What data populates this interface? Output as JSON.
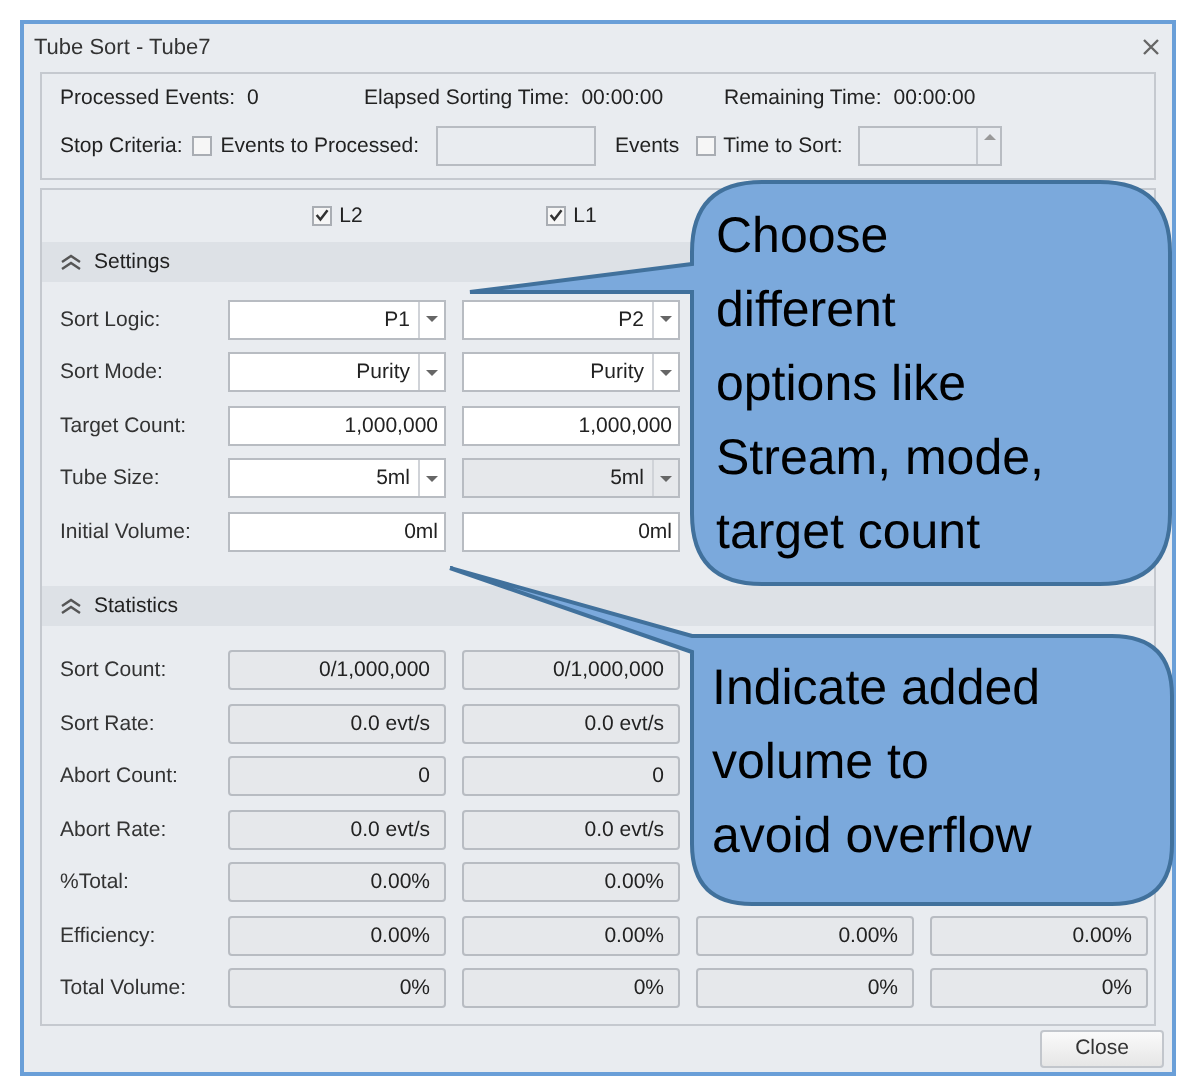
{
  "window": {
    "title": "Tube Sort - Tube7"
  },
  "summary": [
    {
      "label": "Processed Events:",
      "value": "0"
    },
    {
      "label": "Elapsed Sorting Time:",
      "value": "00:00:00"
    },
    {
      "label": "Remaining Time:",
      "value": "00:00:00"
    }
  ],
  "stop_criteria": {
    "label": "Stop Criteria:",
    "events_option": {
      "label": "Events to Processed:",
      "checked": false
    },
    "events_unit": "Events",
    "time_option": {
      "label": "Time to Sort:",
      "checked": false
    }
  },
  "streams": [
    {
      "label": "L2",
      "checked": true
    },
    {
      "label": "L1",
      "checked": true
    }
  ],
  "settings": {
    "title": "Settings",
    "rows": [
      {
        "label": "Sort Logic:",
        "kind": "dropdown",
        "cells": [
          {
            "value": "P1",
            "disabled": false
          },
          {
            "value": "P2",
            "disabled": false
          }
        ]
      },
      {
        "label": "Sort Mode:",
        "kind": "dropdown",
        "cells": [
          {
            "value": "Purity",
            "disabled": false
          },
          {
            "value": "Purity",
            "disabled": false
          }
        ]
      },
      {
        "label": "Target Count:",
        "kind": "input",
        "cells": [
          {
            "value": "1,000,000",
            "disabled": false
          },
          {
            "value": "1,000,000",
            "disabled": false
          }
        ]
      },
      {
        "label": "Tube Size:",
        "kind": "dropdown",
        "cells": [
          {
            "value": "5ml",
            "disabled": false
          },
          {
            "value": "5ml",
            "disabled": true
          }
        ]
      },
      {
        "label": "Initial Volume:",
        "kind": "input",
        "cells": [
          {
            "value": "0ml",
            "disabled": false
          },
          {
            "value": "0ml",
            "disabled": false
          }
        ]
      }
    ]
  },
  "statistics": {
    "title": "Statistics",
    "rows": [
      {
        "label": "Sort Count:",
        "cells": [
          "0/1,000,000",
          "0/1,000,000"
        ]
      },
      {
        "label": "Sort Rate:",
        "cells": [
          "0.0 evt/s",
          "0.0 evt/s"
        ]
      },
      {
        "label": "Abort Count:",
        "cells": [
          "0",
          "0"
        ]
      },
      {
        "label": "Abort Rate:",
        "cells": [
          "0.0 evt/s",
          "0.0 evt/s"
        ]
      },
      {
        "label": "%Total:",
        "cells": [
          "0.00%",
          "0.00%"
        ]
      },
      {
        "label": "Efficiency:",
        "cells": [
          "0.00%",
          "0.00%",
          "0.00%",
          "0.00%"
        ]
      },
      {
        "label": "Total Volume:",
        "cells": [
          "0%",
          "0%",
          "0%",
          "0%"
        ]
      }
    ]
  },
  "close_button": "Close",
  "callouts": [
    {
      "text": "Choose\ndifferent\noptions like\nStream, mode,\ntarget count"
    },
    {
      "text": "Indicate added\nvolume to\navoid overflow"
    }
  ]
}
